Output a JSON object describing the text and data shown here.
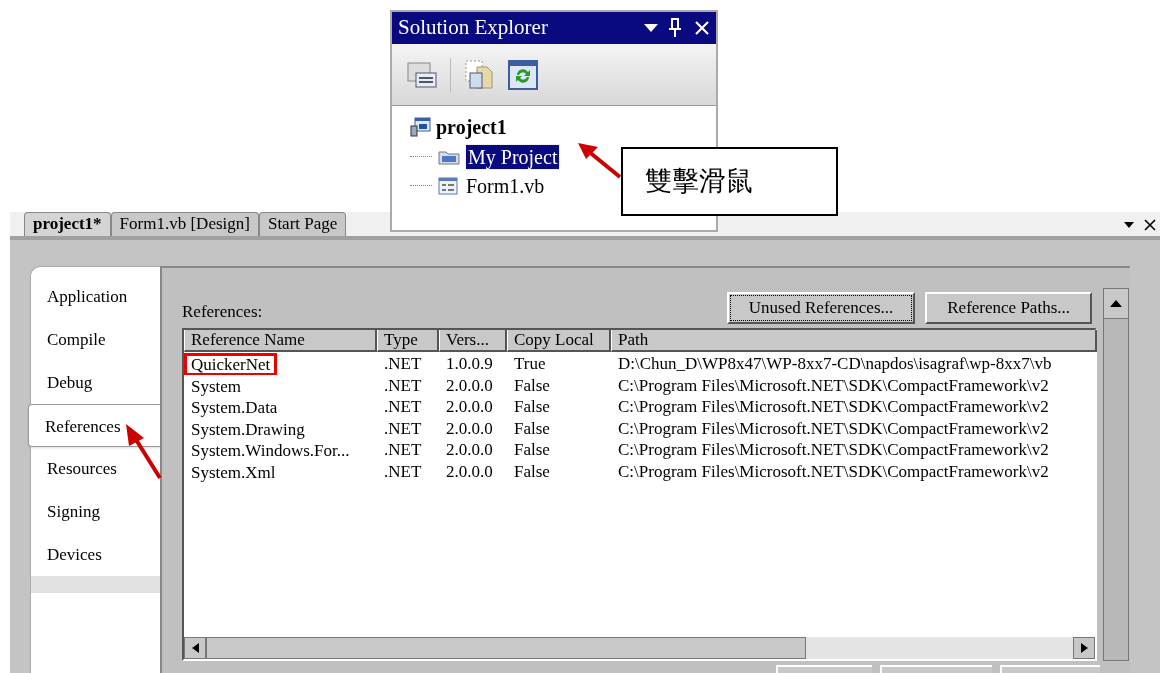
{
  "solution_explorer": {
    "title": "Solution Explorer",
    "tree": [
      {
        "label": "project1",
        "children": [
          {
            "label": "My Project",
            "selected": true
          },
          {
            "label": "Form1.vb",
            "selected": false
          }
        ]
      }
    ]
  },
  "callout": {
    "text": "雙擊滑鼠"
  },
  "editor_tabs": [
    {
      "label": "project1*",
      "selected": true
    },
    {
      "label": "Form1.vb [Design]",
      "selected": false
    },
    {
      "label": "Start Page",
      "selected": false
    }
  ],
  "nav": [
    {
      "label": "Application",
      "selected": false
    },
    {
      "label": "Compile",
      "selected": false
    },
    {
      "label": "Debug",
      "selected": false
    },
    {
      "label": "References",
      "selected": true
    },
    {
      "label": "Resources",
      "selected": false
    },
    {
      "label": "Signing",
      "selected": false
    },
    {
      "label": "Devices",
      "selected": false
    }
  ],
  "references": {
    "label": "References:",
    "buttons": [
      "Unused References...",
      "Reference Paths..."
    ],
    "columns": [
      "Reference Name",
      "Type",
      "Vers...",
      "Copy Local",
      "Path"
    ],
    "rows": [
      {
        "highlighted": true,
        "cells": [
          "QuickerNet",
          ".NET",
          "1.0.0.9",
          "True",
          "D:\\Chun_D\\WP8x47\\WP-8xx7-CD\\napdos\\isagraf\\wp-8xx7\\vb"
        ]
      },
      {
        "highlighted": false,
        "cells": [
          "System",
          ".NET",
          "2.0.0.0",
          "False",
          "C:\\Program Files\\Microsoft.NET\\SDK\\CompactFramework\\v2"
        ]
      },
      {
        "highlighted": false,
        "cells": [
          "System.Data",
          ".NET",
          "2.0.0.0",
          "False",
          "C:\\Program Files\\Microsoft.NET\\SDK\\CompactFramework\\v2"
        ]
      },
      {
        "highlighted": false,
        "cells": [
          "System.Drawing",
          ".NET",
          "2.0.0.0",
          "False",
          "C:\\Program Files\\Microsoft.NET\\SDK\\CompactFramework\\v2"
        ]
      },
      {
        "highlighted": false,
        "cells": [
          "System.Windows.For...",
          ".NET",
          "2.0.0.0",
          "False",
          "C:\\Program Files\\Microsoft.NET\\SDK\\CompactFramework\\v2"
        ]
      },
      {
        "highlighted": false,
        "cells": [
          "System.Xml",
          ".NET",
          "2.0.0.0",
          "False",
          "C:\\Program Files\\Microsoft.NET\\SDK\\CompactFramework\\v2"
        ]
      }
    ]
  }
}
